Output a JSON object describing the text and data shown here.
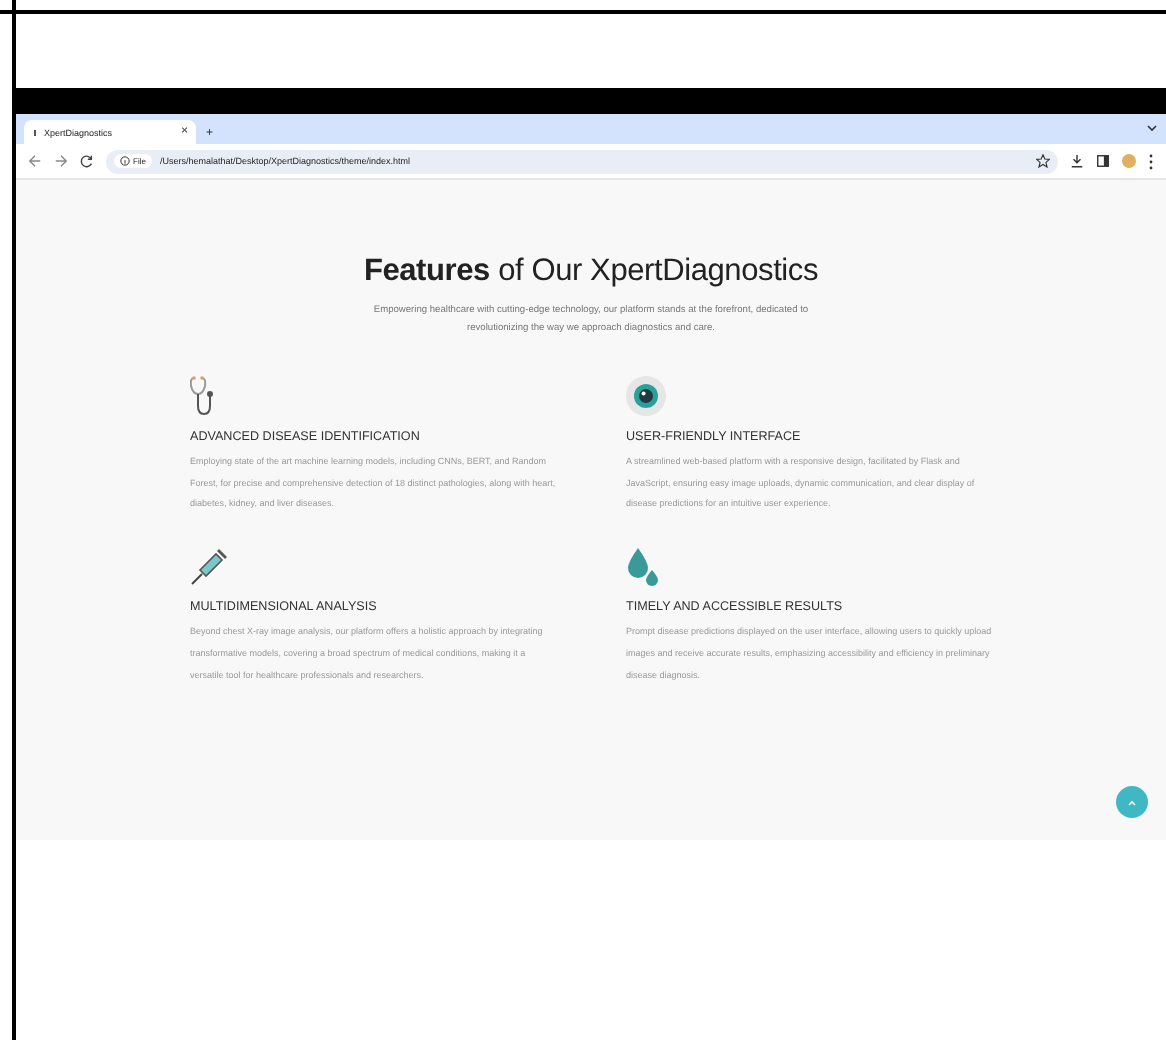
{
  "browser": {
    "tab_title": "XpertDiagnostics",
    "tab_close": "×",
    "new_tab": "+",
    "url_scheme": "File",
    "url": "/Users/hemalathat/Desktop/XpertDiagnostics/theme/index.html"
  },
  "page": {
    "heading": "**Features** of Our XpertDiagnostics",
    "subtitle": "Empowering healthcare with cutting-edge technology, our platform stands at the forefront, dedicated to revolutionizing the way we approach diagnostics and care.",
    "features": [
      {
        "title": "ADVANCED DISEASE IDENTIFICATION",
        "text": "Employing state of the art machine learning models, including CNNs, BERT, and Random Forest, for precise and comprehensive detection of 18 distinct pathologies, along with heart, diabetes, kidney, and liver diseases."
      },
      {
        "title": "USER-FRIENDLY INTERFACE",
        "text": "A streamlined web-based platform with a responsive design, facilitated by Flask and JavaScript, ensuring easy image uploads, dynamic communication, and clear display of disease predictions for an intuitive user experience."
      },
      {
        "title": "MULTIDIMENSIONAL ANALYSIS",
        "text": "Beyond chest X-ray image analysis, our platform offers a holistic approach by integrating transformative models, covering a broad spectrum of medical conditions, making it a versatile tool for healthcare professionals and researchers."
      },
      {
        "title": "TIMELY AND ACCESSIBLE RESULTS",
        "text": "Prompt disease predictions displayed on the user interface, allowing users to quickly upload images and receive accurate results, emphasizing accessibility and efficiency in preliminary disease diagnosis."
      }
    ]
  }
}
